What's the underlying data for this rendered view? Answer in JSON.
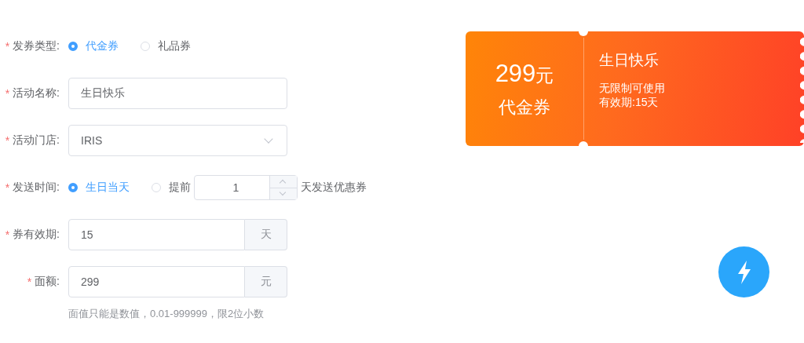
{
  "form": {
    "fields": [
      {
        "kind": "radio",
        "mark": "*",
        "label": "发券类型:",
        "options": [
          {
            "label": "代金券",
            "selected": true
          },
          {
            "label": "礼品券",
            "selected": false
          }
        ]
      },
      {
        "kind": "text",
        "mark": "*",
        "label": "活动名称:",
        "value": "生日快乐"
      },
      {
        "kind": "select",
        "mark": "*",
        "label": "活动门店:",
        "value": "IRIS"
      },
      {
        "kind": "radio_number",
        "mark": "*",
        "label": "发送时间:",
        "options": [
          {
            "label": "生日当天",
            "selected": true
          },
          {
            "label": "提前",
            "selected": false
          }
        ],
        "number": "1",
        "suffix": "天发送优惠券"
      },
      {
        "kind": "addon",
        "mark": "*",
        "label": "券有效期:",
        "value": "15",
        "addon": "天"
      },
      {
        "kind": "addon",
        "mark": "*",
        "label": "面额:",
        "value": "299",
        "addon": "元",
        "hint": "面值只能是数值，0.01-999999，限2位小数"
      }
    ]
  },
  "coupon": {
    "amount": "299",
    "unit": "元",
    "type": "代金券",
    "title": "生日快乐",
    "lines": [
      "无限制可使用",
      "有效期:15天"
    ]
  },
  "fab": {
    "kind": "lightning"
  }
}
